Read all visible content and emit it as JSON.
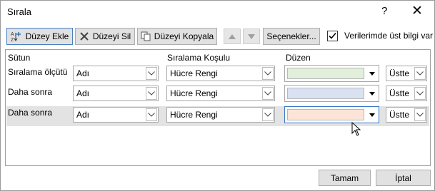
{
  "window": {
    "title": "Sırala",
    "help": "?",
    "close": "✕"
  },
  "toolbar": {
    "add_level": "Düzey Ekle",
    "delete_level": "Düzeyi Sil",
    "copy_level": "Düzeyi Kopyala",
    "options": "Seçenekler...",
    "headers_checkbox_label": "Verilerimde üst bilgi var",
    "headers_checked": true
  },
  "columns": {
    "column": "Sütun",
    "sort_on": "Sıralama Koşulu",
    "order": "Düzen"
  },
  "rows": [
    {
      "label": "Sıralama ölçütü",
      "column_value": "Adı",
      "sort_on_value": "Hücre Rengi",
      "color": "#e2efda",
      "position": "Üstte"
    },
    {
      "label": "Daha sonra",
      "column_value": "Adı",
      "sort_on_value": "Hücre Rengi",
      "color": "#d9e1f2",
      "position": "Üstte"
    },
    {
      "label": "Daha sonra",
      "column_value": "Adı",
      "sort_on_value": "Hücre Rengi",
      "color": "#fce4d6",
      "position": "Üstte"
    }
  ],
  "footer": {
    "ok": "Tamam",
    "cancel": "İptal"
  }
}
